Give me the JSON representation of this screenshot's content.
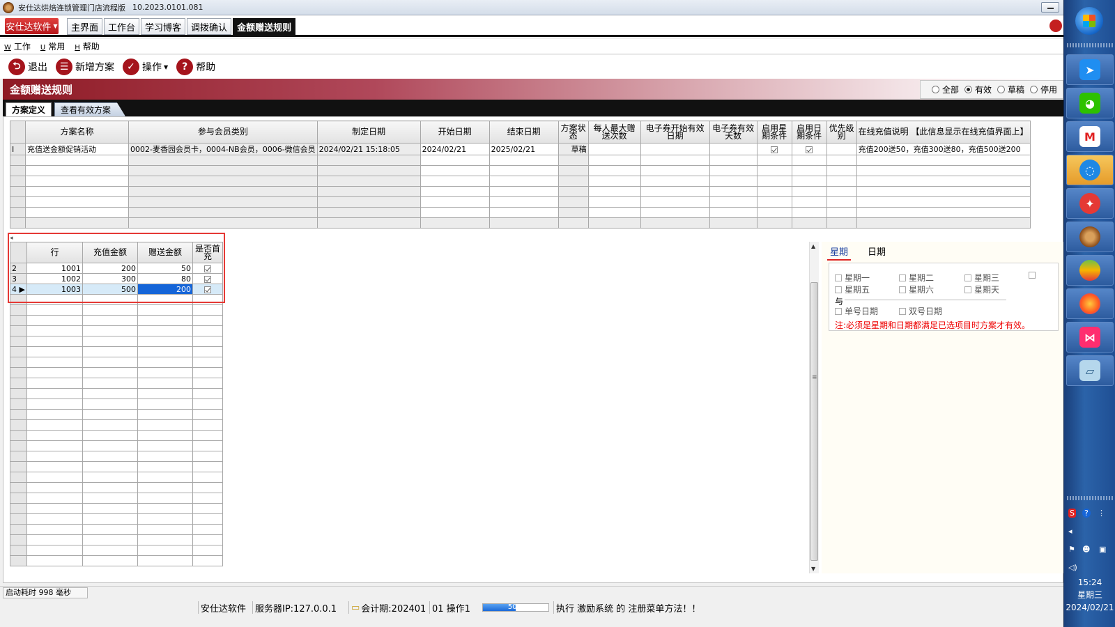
{
  "window": {
    "title": "安仕达烘焙连锁管理门店流程版",
    "version": "10.2023.0101.081"
  },
  "nav": {
    "brand": "安仕达软件",
    "tabs": [
      "主界面",
      "工作台",
      "学习博客",
      "调拨确认",
      "金额赠送规则"
    ]
  },
  "menu": {
    "items": [
      {
        "key": "W",
        "label": "工作"
      },
      {
        "key": "U",
        "label": "常用"
      },
      {
        "key": "H",
        "label": "帮助"
      }
    ]
  },
  "toolbar": {
    "exit": "退出",
    "new_plan": "新增方案",
    "operate": "操作",
    "help": "帮助"
  },
  "banner": {
    "title": "金额赠送规则",
    "filters": [
      "全部",
      "有效",
      "草稿",
      "停用"
    ],
    "selected_filter": "有效"
  },
  "subtabs": [
    "方案定义",
    "查看有效方案"
  ],
  "grid1": {
    "headers": [
      "方案名称",
      "参与会员类别",
      "制定日期",
      "开始日期",
      "结束日期",
      "方案状态",
      "每人最大赠送次数",
      "电子券开始有效日期",
      "电子券有效天数",
      "启用星期条件",
      "启用日期条件",
      "优先级别",
      "在线充值说明 【此信息显示在线充值界面上】"
    ],
    "row": {
      "marker": "I",
      "name": "充值送金额促销活动",
      "member_types": "0002-麦香园会员卡，0004-NB会员，0006-微信会员",
      "created": "2024/02/21 15:18:05",
      "start": "2024/02/21",
      "end": "2025/02/21",
      "status": "草稿",
      "online_desc": "充值200送50，充值300送80，充值500送200"
    }
  },
  "grid2": {
    "headers": [
      "行",
      "充值金额",
      "赠送金额",
      "是否首充"
    ],
    "rows": [
      {
        "idx": "2",
        "line": "1001",
        "recharge": "200",
        "gift": "50"
      },
      {
        "idx": "3",
        "line": "1002",
        "recharge": "300",
        "gift": "80"
      },
      {
        "idx": "4",
        "line": "1003",
        "recharge": "500",
        "gift": "200"
      }
    ]
  },
  "right_panel": {
    "tabs": [
      "星期",
      "日期"
    ],
    "weekdays": [
      "星期一",
      "星期二",
      "星期三",
      "星期五",
      "星期六",
      "星期天"
    ],
    "connector": "与",
    "date_opts": [
      "单号日期",
      "双号日期"
    ],
    "note": "注:必须是星期和日期都满足已选项目时方案才有效。"
  },
  "status": {
    "startup": "启动耗时 998 毫秒",
    "company": "安仕达软件",
    "server": "服务器IP:127.0.0.1",
    "period": "会计期:202401",
    "operator": "01 操作1",
    "progress_text": "50%",
    "progress": 0.5,
    "message": "执行 激励系统 的 注册菜单方法！！"
  },
  "taskbar": {
    "time": "15:24",
    "weekday": "星期三",
    "date": "2024/02/21"
  },
  "colors": {
    "accent_red": "#a5141c",
    "banner_dark": "#8e1a24",
    "selection_blue": "#1565d8",
    "note_red": "#e00000"
  }
}
